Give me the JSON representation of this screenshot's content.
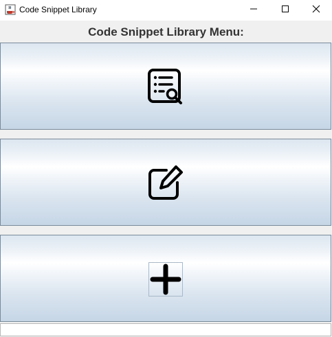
{
  "window": {
    "title": "Code Snippet Library",
    "app_icon": "java-coffee-cup-icon",
    "minimize_icon": "minimize-icon",
    "maximize_icon": "maximize-icon",
    "close_icon": "close-icon"
  },
  "main": {
    "heading": "Code Snippet Library Menu:",
    "buttons": [
      {
        "icon": "search-list-icon"
      },
      {
        "icon": "edit-icon"
      },
      {
        "icon": "plus-icon"
      }
    ]
  },
  "colors": {
    "heading": "#333333",
    "button_gradient_top": "#dce6f0",
    "button_gradient_mid": "#ffffff",
    "button_gradient_bottom": "#c6d6e6",
    "button_border": "#7a8a99"
  }
}
